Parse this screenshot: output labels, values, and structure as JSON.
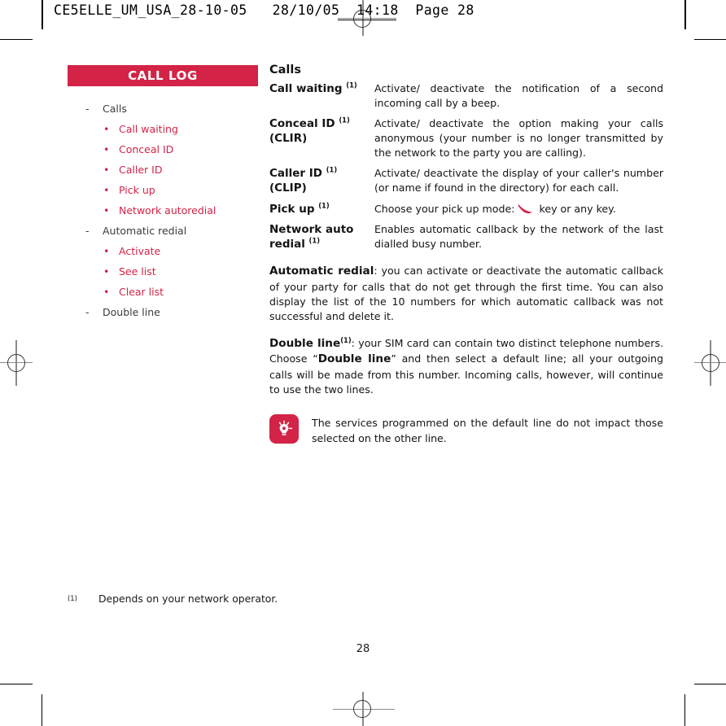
{
  "page_header": {
    "text": "CE5ELLE_UM_USA_28-10-05   28/10/05  14:18  Page 28"
  },
  "sidebar": {
    "title": "CALL LOG",
    "title_color": "#D32346",
    "items": [
      {
        "level": 1,
        "marker": "-",
        "label": "Calls"
      },
      {
        "level": 2,
        "marker": "•",
        "label": "Call waiting"
      },
      {
        "level": 2,
        "marker": "•",
        "label": "Conceal ID"
      },
      {
        "level": 2,
        "marker": "•",
        "label": "Caller ID"
      },
      {
        "level": 2,
        "marker": "•",
        "label": "Pick up"
      },
      {
        "level": 2,
        "marker": "•",
        "label": "Network autoredial"
      },
      {
        "level": 1,
        "marker": "-",
        "label": "Automatic redial"
      },
      {
        "level": 2,
        "marker": "•",
        "label": "Activate"
      },
      {
        "level": 2,
        "marker": "•",
        "label": "See list"
      },
      {
        "level": 2,
        "marker": "•",
        "label": "Clear list"
      },
      {
        "level": 1,
        "marker": "-",
        "label": "Double line"
      }
    ]
  },
  "main": {
    "section_title": "Calls",
    "definitions": [
      {
        "term": "Call waiting",
        "term_line2": "",
        "footnote": "(1)",
        "description": "Activate/ deactivate the notification of a second incoming call by a beep."
      },
      {
        "term": "Conceal ID",
        "term_line2": "(CLIR)",
        "footnote": "(1)",
        "description": "Activate/ deactivate the option making your calls anonymous (your number is no longer transmitted by the network to the party you are calling)."
      },
      {
        "term": "Caller ID",
        "term_line2": "(CLIP)",
        "footnote": "(1)",
        "description": "Activate/ deactivate the display of your caller's number (or name if found in the directory) for each call."
      },
      {
        "term": "Pick up",
        "term_line2": "",
        "footnote": "(1)",
        "description_before_icon": "Choose your pick up mode:",
        "icon": "phone-handset-icon",
        "description_after_icon": "key or any key."
      },
      {
        "term": "Network auto",
        "term_line2": "redial",
        "footnote": "(1)",
        "description": "Enables automatic callback by the network of the last dialled busy number."
      }
    ],
    "paragraphs": [
      {
        "lead": "Automatic redial",
        "footnote": "",
        "body": ": you can activate or deactivate the automatic callback of your party for calls that do not get through the first time. You can also display the list of the 10 numbers for which automatic callback was not successful and delete it."
      },
      {
        "lead": "Double line",
        "footnote": "(1)",
        "body_part1": ": your SIM card can contain two distinct telephone numbers. Choose “",
        "body_emphasis": "Double line",
        "body_part2": "” and then select a default line; all your outgoing calls will be made from this number. Incoming calls, however, will continue to use the two lines."
      }
    ],
    "note": {
      "icon": "lightbulb-tip-icon",
      "icon_bg": "#D32346",
      "text": "The services programmed on the default line do not impact those selected on the other line."
    }
  },
  "footnote": {
    "marker": "(1)",
    "text": "Depends on your network operator."
  },
  "folio": "28"
}
